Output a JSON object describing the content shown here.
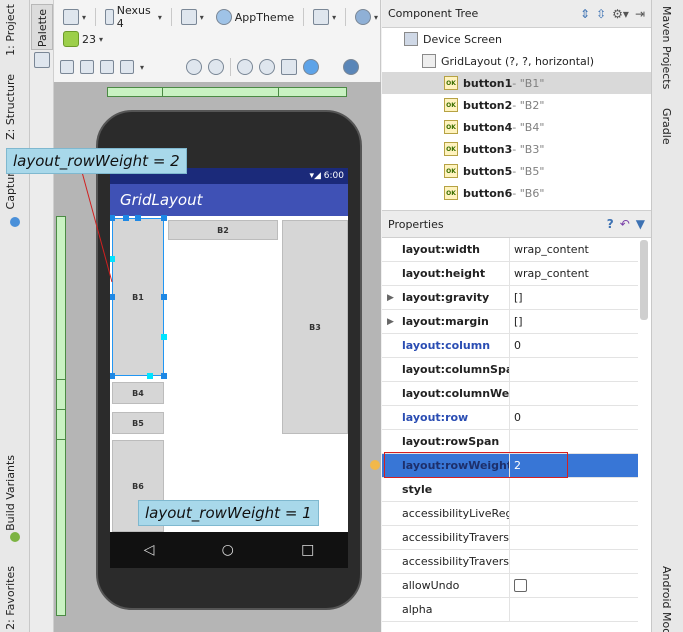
{
  "left_strip": {
    "tabs": [
      "1: Project",
      "Z: Structure",
      "Captures",
      "Build Variants",
      "2: Favorites"
    ]
  },
  "right_strip": {
    "tabs": [
      "Maven Projects",
      "Gradle",
      "Android Model"
    ]
  },
  "palette": {
    "tab": "Palette"
  },
  "toolbar": {
    "device": "Nexus 4",
    "theme": "AppTheme",
    "api": "23"
  },
  "phone": {
    "status_time": "6:00",
    "app_title": "GridLayout",
    "buttons": {
      "b1": "B1",
      "b2": "B2",
      "b3": "B3",
      "b4": "B4",
      "b5": "B5",
      "b6": "B6"
    },
    "nav": {
      "back": "◁",
      "home": "○",
      "recent": "□"
    }
  },
  "callouts": {
    "top": "layout_rowWeight = 2",
    "bottom": "layout_rowWeight = 1"
  },
  "component_tree": {
    "title": "Component Tree",
    "items": [
      {
        "name": "Device Screen",
        "detail": ""
      },
      {
        "name": "GridLayout",
        "detail": "(?, ?, horizontal)"
      },
      {
        "name": "button1",
        "detail": " - \"B1\""
      },
      {
        "name": "button2",
        "detail": " - \"B2\""
      },
      {
        "name": "button4",
        "detail": " - \"B4\""
      },
      {
        "name": "button3",
        "detail": " - \"B3\""
      },
      {
        "name": "button5",
        "detail": " - \"B5\""
      },
      {
        "name": "button6",
        "detail": " - \"B6\""
      }
    ]
  },
  "properties": {
    "title": "Properties",
    "rows": [
      {
        "name": "layout:width",
        "value": "wrap_content"
      },
      {
        "name": "layout:height",
        "value": "wrap_content"
      },
      {
        "name": "layout:gravity",
        "value": "[]"
      },
      {
        "name": "layout:margin",
        "value": "[]"
      },
      {
        "name": "layout:column",
        "value": "0"
      },
      {
        "name": "layout:columnSpan",
        "value": ""
      },
      {
        "name": "layout:columnWeight",
        "value": ""
      },
      {
        "name": "layout:row",
        "value": "0"
      },
      {
        "name": "layout:rowSpan",
        "value": ""
      },
      {
        "name": "layout:rowWeight",
        "value": "2"
      },
      {
        "name": "style",
        "value": ""
      },
      {
        "name": "accessibilityLiveRegion",
        "value": ""
      },
      {
        "name": "accessibilityTraversalAfter",
        "value": ""
      },
      {
        "name": "accessibilityTraversalBefore",
        "value": ""
      },
      {
        "name": "allowUndo",
        "value": ""
      },
      {
        "name": "alpha",
        "value": ""
      }
    ]
  },
  "colors": {
    "selection": "#3876d6",
    "appbar": "#3f51b5",
    "callout": "#a8d8ea",
    "ruler": "#c9f2c2",
    "highlight_box": "#d62020"
  }
}
